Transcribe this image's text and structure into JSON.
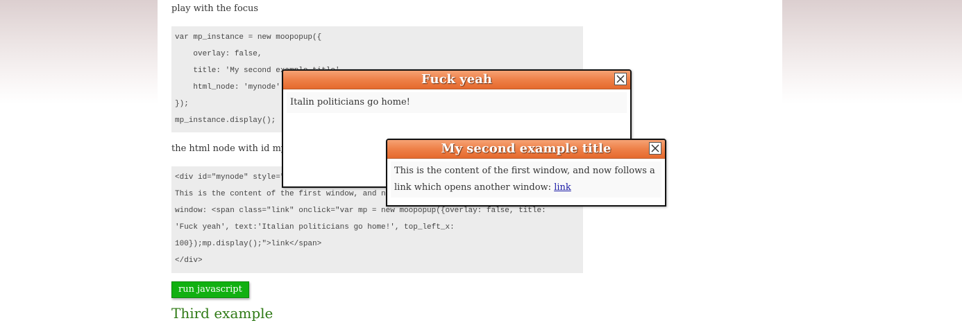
{
  "intro": {
    "text": "play with the focus"
  },
  "code1": {
    "lines": [
      "var mp_instance = new moopopup({",
      "    overlay: false,",
      "    title: 'My second example title',",
      "    html_node: 'mynode'",
      "});",
      "mp_instance.display();"
    ]
  },
  "node_text": "the html node with id mynode",
  "code2": {
    "lines": [
      "<div id=\"mynode\" style=\"display:none\">",
      "This is the content of the first window, and now follows a link which opens another",
      "window: <span class=\"link\" onclick=\"var mp = new moopopup({overlay: false, title:",
      "'Fuck yeah', text:'Italian politicians go home!', top_left_x:",
      "100});mp.display();\">link</span>",
      "</div>"
    ]
  },
  "run_button": {
    "label": "run javascript"
  },
  "section_title": "Third example",
  "popup1": {
    "title": "Fuck yeah",
    "content": "Italin politicians go home!"
  },
  "popup2": {
    "title": "My second example title",
    "content": "This is the content of the first window, and now follows a link which opens another window:",
    "link": "link"
  },
  "colors": {
    "popup_header": "#ee8048",
    "run_button": "#11b011",
    "section_title": "#2f7a16",
    "link": "#1a1aa6"
  },
  "icons": {
    "close": "close-icon"
  }
}
